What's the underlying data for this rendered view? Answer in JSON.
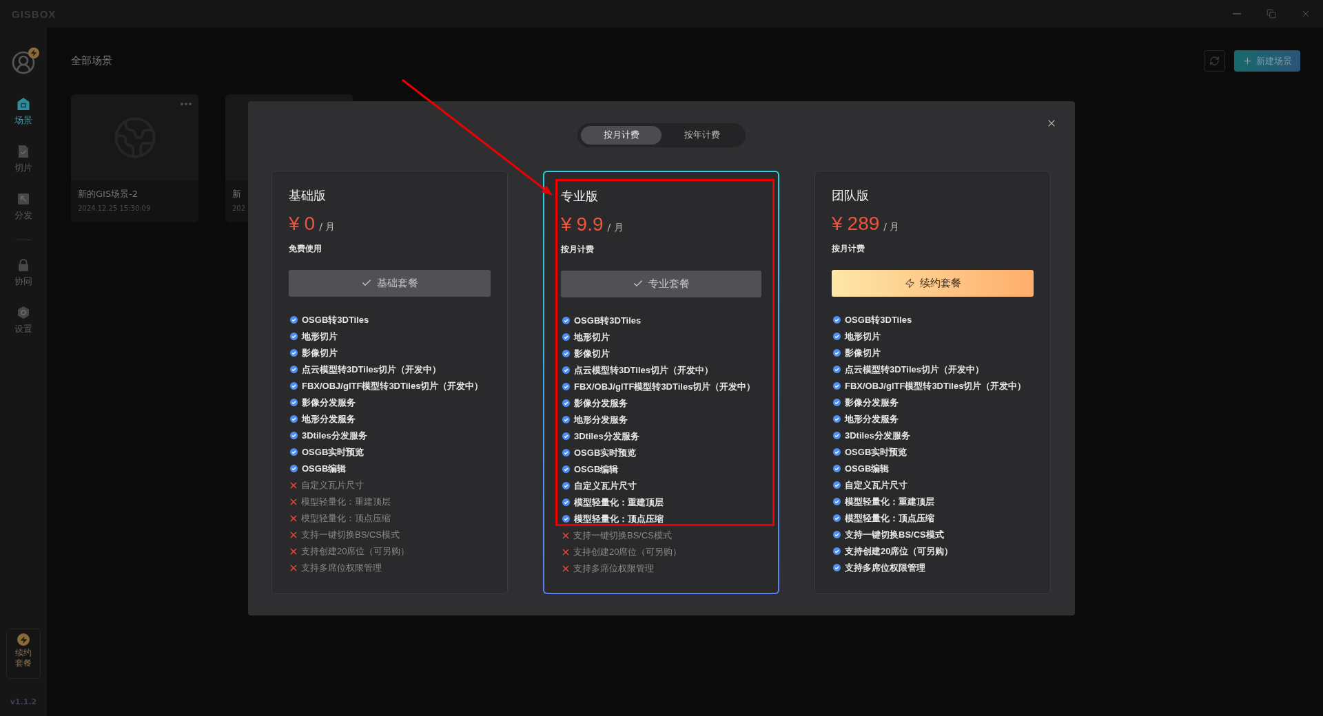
{
  "titlebar": {
    "logo": "GISBOX"
  },
  "sidebar": {
    "sections": [
      {
        "items": [
          {
            "label": "场景",
            "selected": true
          },
          {
            "label": "切片",
            "selected": false
          },
          {
            "label": "分发",
            "selected": false
          }
        ]
      },
      {
        "items": [
          {
            "label": "协同",
            "selected": false
          },
          {
            "label": "设置",
            "selected": false
          }
        ]
      }
    ],
    "renew_button": "续约套餐",
    "version": "v1.1.2"
  },
  "main": {
    "title": "全部场景",
    "new_button": "新建场景",
    "scenes": [
      {
        "kind": "full",
        "title": "新的GIS场景-2",
        "date": "2024.12.25 15:30:09"
      },
      {
        "kind": "covered",
        "title": "新",
        "date": "202"
      }
    ]
  },
  "dialog": {
    "billing_tabs": [
      {
        "label": "按月计费",
        "selected": true
      },
      {
        "label": "按年计费",
        "selected": false
      }
    ],
    "plans": [
      {
        "name": "基础版",
        "currency": "¥",
        "amount": "0",
        "unit": "/ 月",
        "note": "免费使用",
        "selected": false,
        "button": {
          "kind": "current",
          "label": "基础套餐"
        },
        "features": [
          {
            "label": "OSGB转3DTiles",
            "included": true
          },
          {
            "label": "地形切片",
            "included": true
          },
          {
            "label": "影像切片",
            "included": true
          },
          {
            "label": "点云模型转3DTiles切片（开发中）",
            "included": true
          },
          {
            "label": "FBX/OBJ/glTF模型转3DTiles切片（开发中）",
            "included": true
          },
          {
            "label": "影像分发服务",
            "included": true
          },
          {
            "label": "地形分发服务",
            "included": true
          },
          {
            "label": "3Dtiles分发服务",
            "included": true
          },
          {
            "label": "OSGB实时预览",
            "included": true
          },
          {
            "label": "OSGB编辑",
            "included": true
          },
          {
            "label": "自定义瓦片尺寸",
            "included": false
          },
          {
            "label": "模型轻量化：重建顶层",
            "included": false
          },
          {
            "label": "模型轻量化：顶点压缩",
            "included": false
          },
          {
            "label": "支持一键切换BS/CS模式",
            "included": false
          },
          {
            "label": "支持创建20席位（可另购）",
            "included": false
          },
          {
            "label": "支持多席位权限管理",
            "included": false
          }
        ]
      },
      {
        "name": "专业版",
        "currency": "¥",
        "amount": "9.9",
        "unit": "/ 月",
        "note": "按月计费",
        "selected": true,
        "button": {
          "kind": "current",
          "label": "专业套餐"
        },
        "features": [
          {
            "label": "OSGB转3DTiles",
            "included": true
          },
          {
            "label": "地形切片",
            "included": true
          },
          {
            "label": "影像切片",
            "included": true
          },
          {
            "label": "点云模型转3DTiles切片（开发中）",
            "included": true
          },
          {
            "label": "FBX/OBJ/glTF模型转3DTiles切片（开发中）",
            "included": true
          },
          {
            "label": "影像分发服务",
            "included": true
          },
          {
            "label": "地形分发服务",
            "included": true
          },
          {
            "label": "3Dtiles分发服务",
            "included": true
          },
          {
            "label": "OSGB实时预览",
            "included": true
          },
          {
            "label": "OSGB编辑",
            "included": true
          },
          {
            "label": "自定义瓦片尺寸",
            "included": true
          },
          {
            "label": "模型轻量化：重建顶层",
            "included": true
          },
          {
            "label": "模型轻量化：顶点压缩",
            "included": true
          },
          {
            "label": "支持一键切换BS/CS模式",
            "included": false
          },
          {
            "label": "支持创建20席位（可另购）",
            "included": false
          },
          {
            "label": "支持多席位权限管理",
            "included": false
          }
        ]
      },
      {
        "name": "团队版",
        "currency": "¥",
        "amount": "289",
        "unit": "/ 月",
        "note": "按月计费",
        "selected": false,
        "button": {
          "kind": "renew",
          "label": "续约套餐"
        },
        "features": [
          {
            "label": "OSGB转3DTiles",
            "included": true
          },
          {
            "label": "地形切片",
            "included": true
          },
          {
            "label": "影像切片",
            "included": true
          },
          {
            "label": "点云模型转3DTiles切片（开发中）",
            "included": true
          },
          {
            "label": "FBX/OBJ/glTF模型转3DTiles切片（开发中）",
            "included": true
          },
          {
            "label": "影像分发服务",
            "included": true
          },
          {
            "label": "地形分发服务",
            "included": true
          },
          {
            "label": "3Dtiles分发服务",
            "included": true
          },
          {
            "label": "OSGB实时预览",
            "included": true
          },
          {
            "label": "OSGB编辑",
            "included": true
          },
          {
            "label": "自定义瓦片尺寸",
            "included": true
          },
          {
            "label": "模型轻量化：重建顶层",
            "included": true
          },
          {
            "label": "模型轻量化：顶点压缩",
            "included": true
          },
          {
            "label": "支持一键切换BS/CS模式",
            "included": true
          },
          {
            "label": "支持创建20席位（可另购）",
            "included": true
          },
          {
            "label": "支持多席位权限管理",
            "included": true
          }
        ]
      }
    ]
  }
}
